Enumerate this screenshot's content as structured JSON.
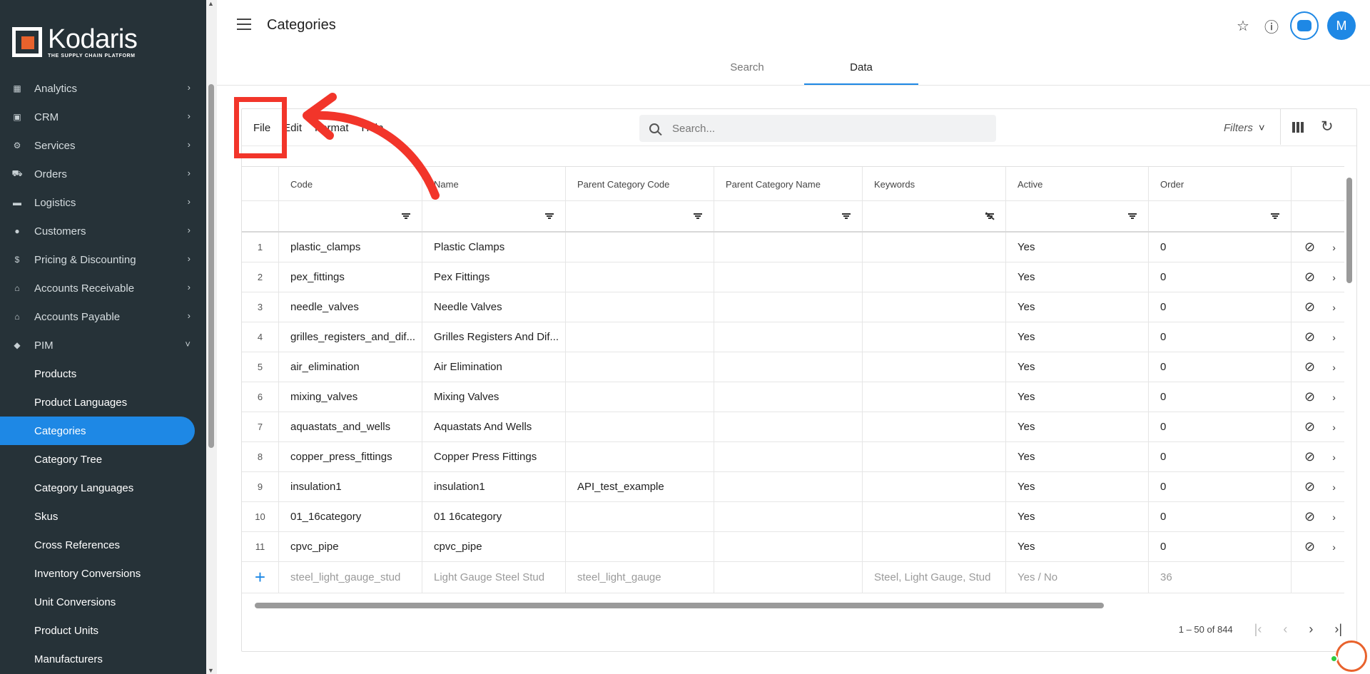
{
  "brand": {
    "name": "Kodaris",
    "tagline": "THE SUPPLY CHAIN PLATFORM"
  },
  "nav": [
    {
      "label": "Analytics",
      "icon": "chart-icon"
    },
    {
      "label": "CRM",
      "icon": "crm-icon"
    },
    {
      "label": "Services",
      "icon": "gears-icon"
    },
    {
      "label": "Orders",
      "icon": "truck-icon"
    },
    {
      "label": "Logistics",
      "icon": "van-icon"
    },
    {
      "label": "Customers",
      "icon": "people-icon"
    },
    {
      "label": "Pricing & Discounting",
      "icon": "dollar-icon"
    },
    {
      "label": "Accounts Receivable",
      "icon": "bank-icon"
    },
    {
      "label": "Accounts Payable",
      "icon": "bank-icon"
    },
    {
      "label": "PIM",
      "icon": "tag-icon"
    }
  ],
  "pim_items": [
    "Products",
    "Product Languages",
    "Categories",
    "Category Tree",
    "Category Languages",
    "Skus",
    "Cross References",
    "Inventory Conversions",
    "Unit Conversions",
    "Product Units",
    "Manufacturers"
  ],
  "header": {
    "title": "Categories",
    "avatar": "M"
  },
  "tabs": [
    "Search",
    "Data"
  ],
  "menu": [
    "File",
    "Edit",
    "Format",
    "Help"
  ],
  "search": {
    "placeholder": "Search..."
  },
  "filters_label": "Filters",
  "columns": [
    "Code",
    "Name",
    "Parent Category Code",
    "Parent Category Name",
    "Keywords",
    "Active",
    "Order"
  ],
  "rows": [
    {
      "n": "1",
      "code": "plastic_clamps",
      "name": "Plastic Clamps",
      "pcode": "",
      "pname": "",
      "kw": "",
      "active": "Yes",
      "order": "0"
    },
    {
      "n": "2",
      "code": "pex_fittings",
      "name": "Pex Fittings",
      "pcode": "",
      "pname": "",
      "kw": "",
      "active": "Yes",
      "order": "0"
    },
    {
      "n": "3",
      "code": "needle_valves",
      "name": "Needle Valves",
      "pcode": "",
      "pname": "",
      "kw": "",
      "active": "Yes",
      "order": "0"
    },
    {
      "n": "4",
      "code": "grilles_registers_and_dif...",
      "name": "Grilles Registers And Dif...",
      "pcode": "",
      "pname": "",
      "kw": "",
      "active": "Yes",
      "order": "0"
    },
    {
      "n": "5",
      "code": "air_elimination",
      "name": "Air Elimination",
      "pcode": "",
      "pname": "",
      "kw": "",
      "active": "Yes",
      "order": "0"
    },
    {
      "n": "6",
      "code": "mixing_valves",
      "name": "Mixing Valves",
      "pcode": "",
      "pname": "",
      "kw": "",
      "active": "Yes",
      "order": "0"
    },
    {
      "n": "7",
      "code": "aquastats_and_wells",
      "name": "Aquastats And Wells",
      "pcode": "",
      "pname": "",
      "kw": "",
      "active": "Yes",
      "order": "0"
    },
    {
      "n": "8",
      "code": "copper_press_fittings",
      "name": "Copper Press Fittings",
      "pcode": "",
      "pname": "",
      "kw": "",
      "active": "Yes",
      "order": "0"
    },
    {
      "n": "9",
      "code": "insulation1",
      "name": "insulation1",
      "pcode": "API_test_example",
      "pname": "",
      "kw": "",
      "active": "Yes",
      "order": "0"
    },
    {
      "n": "10",
      "code": "01_16category",
      "name": "01 16category",
      "pcode": "",
      "pname": "",
      "kw": "",
      "active": "Yes",
      "order": "0"
    },
    {
      "n": "11",
      "code": "cpvc_pipe",
      "name": "cpvc_pipe",
      "pcode": "",
      "pname": "",
      "kw": "",
      "active": "Yes",
      "order": "0"
    }
  ],
  "new_row": {
    "code": "steel_light_gauge_stud",
    "name": "Light Gauge Steel Stud",
    "pcode": "steel_light_gauge",
    "pname": "",
    "kw": "Steel, Light Gauge, Stud",
    "active": "Yes / No",
    "order": "36"
  },
  "pagination": {
    "range": "1 – 50 of 844"
  },
  "colors": {
    "sidebar": "#263238",
    "accent": "#1e88e5",
    "highlight": "#f2352a",
    "brand_orange": "#e8622c"
  }
}
